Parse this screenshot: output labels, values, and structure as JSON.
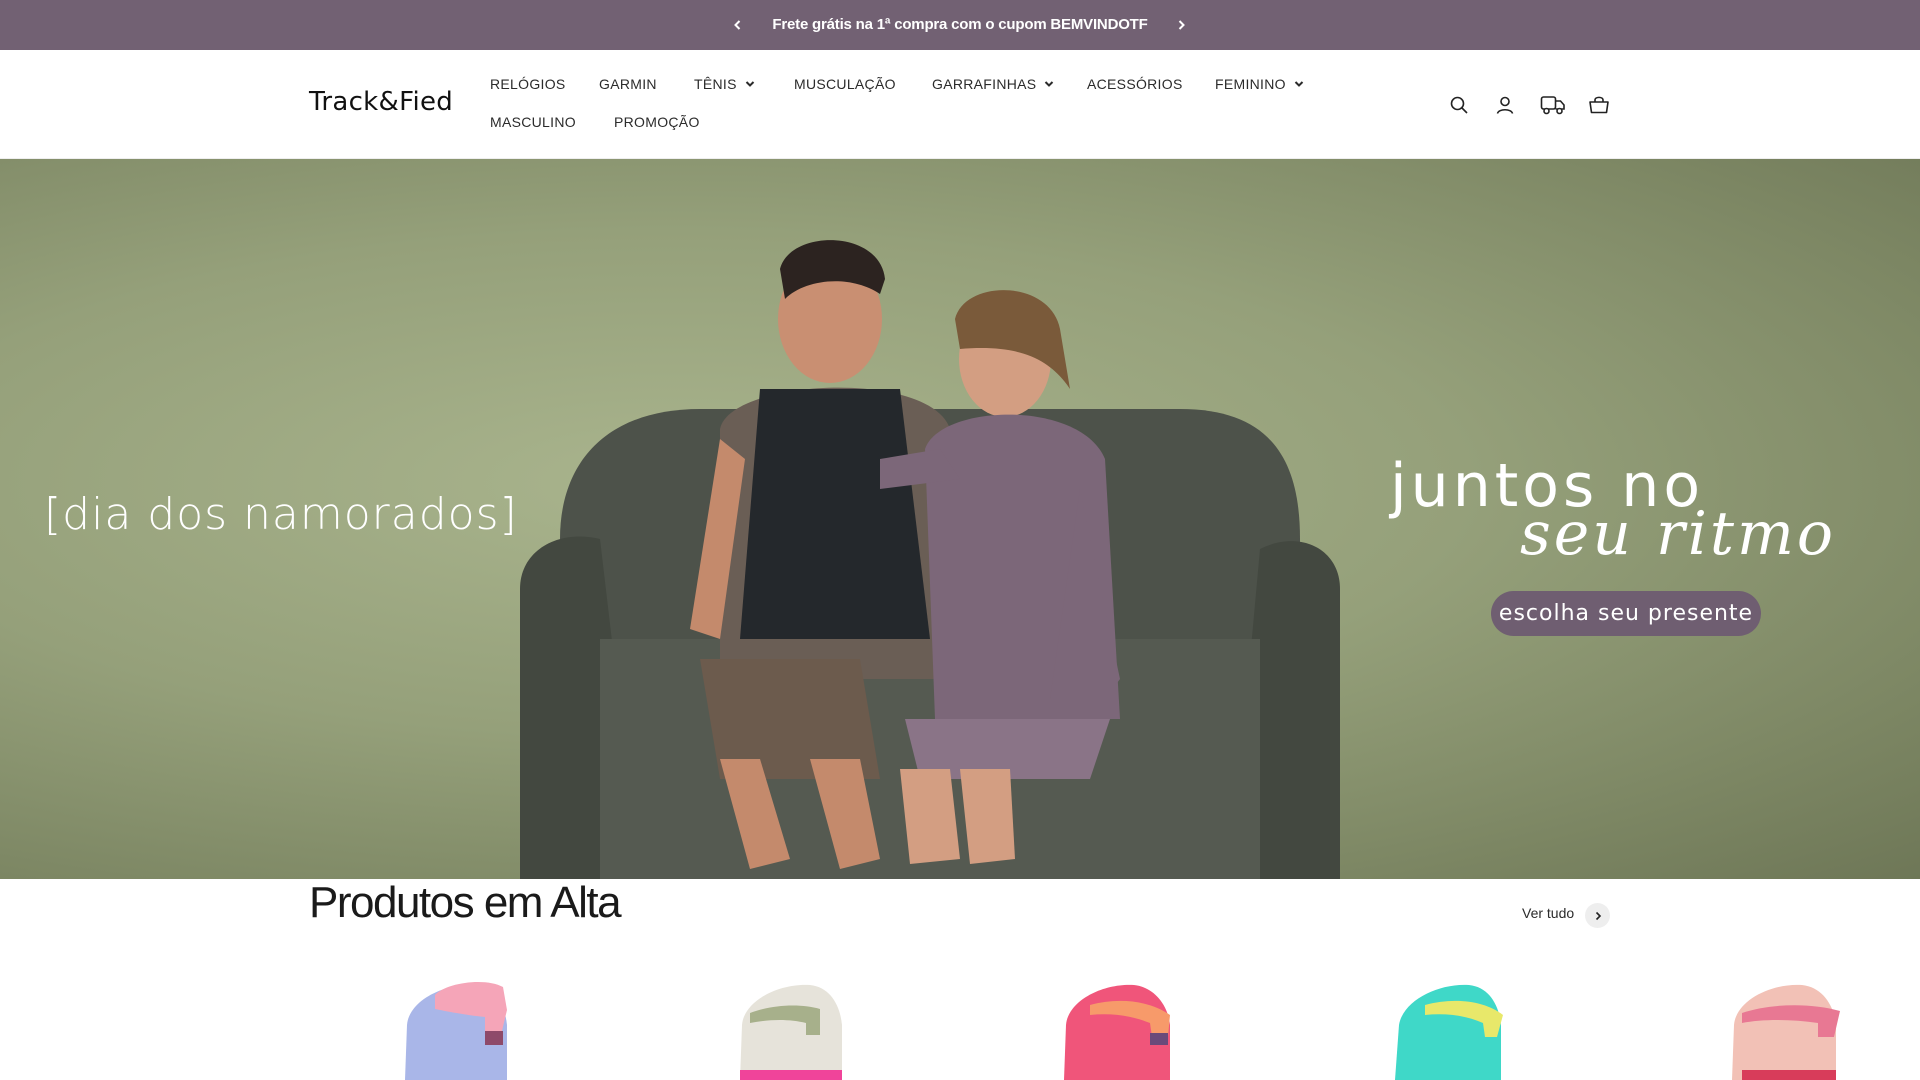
{
  "announcement": {
    "text": "Frete grátis na 1ª compra com o cupom BEMVINDOTF",
    "prev_icon": "chevron-left-icon",
    "next_icon": "chevron-right-icon",
    "background": "#726173"
  },
  "header": {
    "logo": "Track&Fied",
    "nav": [
      {
        "label": "RELÓGIOS",
        "dropdown": false
      },
      {
        "label": "GARMIN",
        "dropdown": false
      },
      {
        "label": "TÊNIS",
        "dropdown": true
      },
      {
        "label": "MUSCULAÇÃO",
        "dropdown": false
      },
      {
        "label": "GARRAFINHAS",
        "dropdown": true
      },
      {
        "label": "ACESSÓRIOS",
        "dropdown": false
      },
      {
        "label": "FEMININO",
        "dropdown": true
      },
      {
        "label": "MASCULINO",
        "dropdown": false
      },
      {
        "label": "PROMOÇÃO",
        "dropdown": false
      }
    ],
    "icons": [
      "search-icon",
      "account-icon",
      "delivery-truck-icon",
      "cart-icon"
    ]
  },
  "hero": {
    "left_text": "[dia dos namorados]",
    "headline_1": "juntos no",
    "headline_2": "seu ritmo",
    "cta": "escolha seu presente",
    "cta_color": "#6f5e71"
  },
  "products_section": {
    "title": "Produtos em Alta",
    "view_all": "Ver tudo",
    "products": [
      {
        "icon": "water-bottle-icon",
        "body_color": "#a9b6e8",
        "lid_color": "#f5a5b8"
      },
      {
        "icon": "water-bottle-icon",
        "body_color": "#e6e3da",
        "lid_color": "#a7b08b"
      },
      {
        "icon": "water-bottle-icon",
        "body_color": "#f0557a",
        "lid_color": "#f79a6a"
      },
      {
        "icon": "water-bottle-icon",
        "body_color": "#3fd8c8",
        "lid_color": "#e8e86a"
      },
      {
        "icon": "water-bottle-icon",
        "body_color": "#f2c1b6",
        "lid_color": "#e87893"
      }
    ]
  }
}
